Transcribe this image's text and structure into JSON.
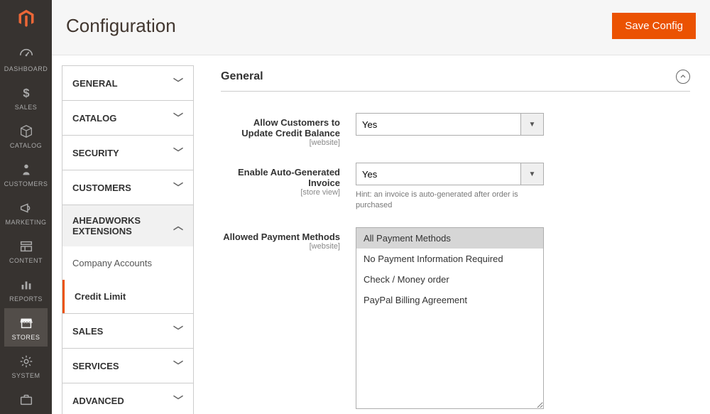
{
  "page_title": "Configuration",
  "save_button": "Save Config",
  "nav": [
    {
      "label": "DASHBOARD",
      "icon": "dashboard"
    },
    {
      "label": "SALES",
      "icon": "dollar"
    },
    {
      "label": "CATALOG",
      "icon": "cube"
    },
    {
      "label": "CUSTOMERS",
      "icon": "person"
    },
    {
      "label": "MARKETING",
      "icon": "megaphone"
    },
    {
      "label": "CONTENT",
      "icon": "blocks"
    },
    {
      "label": "REPORTS",
      "icon": "bars"
    },
    {
      "label": "STORES",
      "icon": "store",
      "active": true
    },
    {
      "label": "SYSTEM",
      "icon": "gear"
    },
    {
      "label": "",
      "icon": "briefcase"
    }
  ],
  "config_tabs": [
    {
      "label": "GENERAL"
    },
    {
      "label": "CATALOG"
    },
    {
      "label": "SECURITY"
    },
    {
      "label": "CUSTOMERS"
    },
    {
      "label": "AHEADWORKS EXTENSIONS",
      "expanded": true,
      "items": [
        {
          "label": "Company Accounts"
        },
        {
          "label": "Credit Limit",
          "active": true
        }
      ]
    },
    {
      "label": "SALES"
    },
    {
      "label": "SERVICES"
    },
    {
      "label": "ADVANCED"
    }
  ],
  "form": {
    "section_title": "General",
    "fields": {
      "allow_update": {
        "label": "Allow Customers to Update Credit Balance",
        "scope": "[website]",
        "value": "Yes"
      },
      "auto_invoice": {
        "label": "Enable Auto-Generated Invoice",
        "scope": "[store view]",
        "value": "Yes",
        "hint": "Hint: an invoice is auto-generated after order is purchased"
      },
      "payment_methods": {
        "label": "Allowed Payment Methods",
        "scope": "[website]",
        "options": [
          {
            "label": "All Payment Methods",
            "selected": true
          },
          {
            "label": "No Payment Information Required"
          },
          {
            "label": "Check / Money order"
          },
          {
            "label": "PayPal Billing Agreement"
          }
        ]
      }
    }
  }
}
